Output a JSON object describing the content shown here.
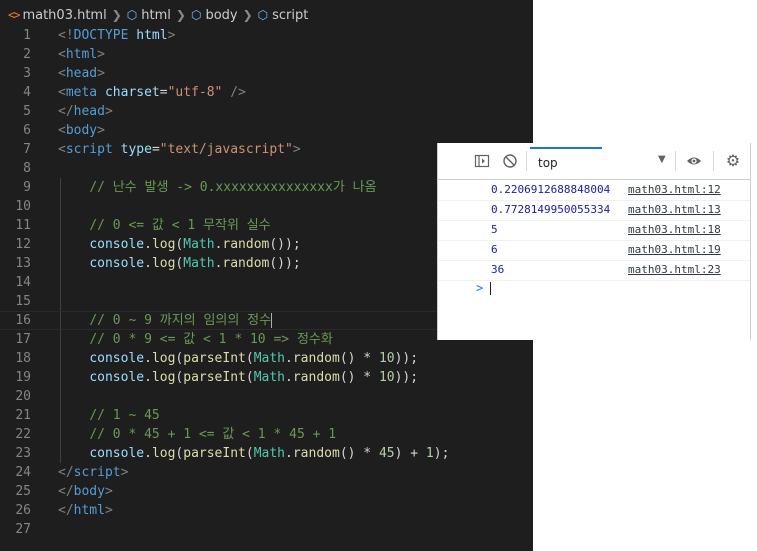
{
  "breadcrumb": {
    "file": "math03.html",
    "items": [
      "html",
      "body",
      "script"
    ]
  },
  "editor": {
    "lines": [
      {
        "n": "1",
        "tokens": [
          [
            "punc",
            "<!"
          ],
          [
            "tag",
            "DOCTYPE"
          ],
          [
            "plain",
            " "
          ],
          [
            "attr",
            "html"
          ],
          [
            "punc",
            ">"
          ]
        ]
      },
      {
        "n": "2",
        "tokens": [
          [
            "punc",
            "<"
          ],
          [
            "tag",
            "html"
          ],
          [
            "punc",
            ">"
          ]
        ]
      },
      {
        "n": "3",
        "tokens": [
          [
            "punc",
            "<"
          ],
          [
            "tag",
            "head"
          ],
          [
            "punc",
            ">"
          ]
        ]
      },
      {
        "n": "4",
        "tokens": [
          [
            "punc",
            "<"
          ],
          [
            "tag",
            "meta"
          ],
          [
            "plain",
            " "
          ],
          [
            "attr",
            "charset"
          ],
          [
            "plain",
            "="
          ],
          [
            "str",
            "\"utf-8\""
          ],
          [
            "plain",
            " "
          ],
          [
            "punc",
            "/>"
          ]
        ]
      },
      {
        "n": "5",
        "tokens": [
          [
            "punc",
            "</"
          ],
          [
            "tag",
            "head"
          ],
          [
            "punc",
            ">"
          ]
        ]
      },
      {
        "n": "6",
        "tokens": [
          [
            "punc",
            "<"
          ],
          [
            "tag",
            "body"
          ],
          [
            "punc",
            ">"
          ]
        ]
      },
      {
        "n": "7",
        "tokens": [
          [
            "punc",
            "<"
          ],
          [
            "tag",
            "script"
          ],
          [
            "plain",
            " "
          ],
          [
            "attr",
            "type"
          ],
          [
            "plain",
            "="
          ],
          [
            "str",
            "\"text/javascript\""
          ],
          [
            "punc",
            ">"
          ]
        ]
      },
      {
        "n": "8",
        "tokens": []
      },
      {
        "n": "9",
        "tokens": [
          [
            "plain",
            "    "
          ],
          [
            "com",
            "// 난수 발생 -> 0.xxxxxxxxxxxxxxx가 나옴"
          ]
        ]
      },
      {
        "n": "10",
        "tokens": []
      },
      {
        "n": "11",
        "tokens": [
          [
            "plain",
            "    "
          ],
          [
            "com",
            "// 0 <= 값 < 1 무작위 실수"
          ]
        ]
      },
      {
        "n": "12",
        "tokens": [
          [
            "plain",
            "    "
          ],
          [
            "attr",
            "console"
          ],
          [
            "plain",
            "."
          ],
          [
            "fn",
            "log"
          ],
          [
            "plain",
            "("
          ],
          [
            "cls",
            "Math"
          ],
          [
            "plain",
            "."
          ],
          [
            "fn",
            "random"
          ],
          [
            "plain",
            "());"
          ]
        ]
      },
      {
        "n": "13",
        "tokens": [
          [
            "plain",
            "    "
          ],
          [
            "attr",
            "console"
          ],
          [
            "plain",
            "."
          ],
          [
            "fn",
            "log"
          ],
          [
            "plain",
            "("
          ],
          [
            "cls",
            "Math"
          ],
          [
            "plain",
            "."
          ],
          [
            "fn",
            "random"
          ],
          [
            "plain",
            "());"
          ]
        ]
      },
      {
        "n": "14",
        "tokens": []
      },
      {
        "n": "15",
        "tokens": []
      },
      {
        "n": "16",
        "tokens": [
          [
            "plain",
            "    "
          ],
          [
            "com",
            "// 0 ~ 9 까지의 임의의 정수"
          ]
        ],
        "active": true
      },
      {
        "n": "17",
        "tokens": [
          [
            "plain",
            "    "
          ],
          [
            "com",
            "// 0 * 9 <= 값 < 1 * 10 => 정수화"
          ]
        ]
      },
      {
        "n": "18",
        "tokens": [
          [
            "plain",
            "    "
          ],
          [
            "attr",
            "console"
          ],
          [
            "plain",
            "."
          ],
          [
            "fn",
            "log"
          ],
          [
            "plain",
            "("
          ],
          [
            "fn",
            "parseInt"
          ],
          [
            "plain",
            "("
          ],
          [
            "cls",
            "Math"
          ],
          [
            "plain",
            "."
          ],
          [
            "fn",
            "random"
          ],
          [
            "plain",
            "() * "
          ],
          [
            "num",
            "10"
          ],
          [
            "plain",
            "));"
          ]
        ]
      },
      {
        "n": "19",
        "tokens": [
          [
            "plain",
            "    "
          ],
          [
            "attr",
            "console"
          ],
          [
            "plain",
            "."
          ],
          [
            "fn",
            "log"
          ],
          [
            "plain",
            "("
          ],
          [
            "fn",
            "parseInt"
          ],
          [
            "plain",
            "("
          ],
          [
            "cls",
            "Math"
          ],
          [
            "plain",
            "."
          ],
          [
            "fn",
            "random"
          ],
          [
            "plain",
            "() * "
          ],
          [
            "num",
            "10"
          ],
          [
            "plain",
            "));"
          ]
        ]
      },
      {
        "n": "20",
        "tokens": []
      },
      {
        "n": "21",
        "tokens": [
          [
            "plain",
            "    "
          ],
          [
            "com",
            "// 1 ~ 45"
          ]
        ]
      },
      {
        "n": "22",
        "tokens": [
          [
            "plain",
            "    "
          ],
          [
            "com",
            "// 0 * 45 + 1 <= 값 < 1 * 45 + 1"
          ]
        ]
      },
      {
        "n": "23",
        "tokens": [
          [
            "plain",
            "    "
          ],
          [
            "attr",
            "console"
          ],
          [
            "plain",
            "."
          ],
          [
            "fn",
            "log"
          ],
          [
            "plain",
            "("
          ],
          [
            "fn",
            "parseInt"
          ],
          [
            "plain",
            "("
          ],
          [
            "cls",
            "Math"
          ],
          [
            "plain",
            "."
          ],
          [
            "fn",
            "random"
          ],
          [
            "plain",
            "() * "
          ],
          [
            "num",
            "45"
          ],
          [
            "plain",
            ") + "
          ],
          [
            "num",
            "1"
          ],
          [
            "plain",
            ");"
          ]
        ]
      },
      {
        "n": "24",
        "tokens": [
          [
            "punc",
            "</"
          ],
          [
            "tag",
            "script"
          ],
          [
            "punc",
            ">"
          ]
        ]
      },
      {
        "n": "25",
        "tokens": [
          [
            "punc",
            "</"
          ],
          [
            "tag",
            "body"
          ],
          [
            "punc",
            ">"
          ]
        ]
      },
      {
        "n": "26",
        "tokens": [
          [
            "punc",
            "</"
          ],
          [
            "tag",
            "html"
          ],
          [
            "punc",
            ">"
          ]
        ]
      },
      {
        "n": "27",
        "tokens": []
      }
    ]
  },
  "console": {
    "context": "top",
    "messages": [
      {
        "value": "0.2206912688848004",
        "source": "math03.html:12"
      },
      {
        "value": "0.7728149950055334",
        "source": "math03.html:13"
      },
      {
        "value": "5",
        "source": "math03.html:18"
      },
      {
        "value": "6",
        "source": "math03.html:19"
      },
      {
        "value": "36",
        "source": "math03.html:23"
      }
    ],
    "prompt": ">"
  },
  "colors": {
    "editor_bg": "#1e1e1e",
    "comment": "#6a9955",
    "keyword": "#569cd6",
    "string": "#ce9178",
    "function": "#dcdcaa",
    "class": "#4ec9b0",
    "variable": "#9cdcfe",
    "number": "#b5cea8",
    "console_value": "#1a1aa6",
    "accent": "#1a73e8"
  },
  "icons": [
    "html-file-icon",
    "symbol-structure-icon",
    "show-sidebar-icon",
    "clear-console-icon",
    "chevron-down-icon",
    "eye-icon",
    "gear-icon"
  ]
}
